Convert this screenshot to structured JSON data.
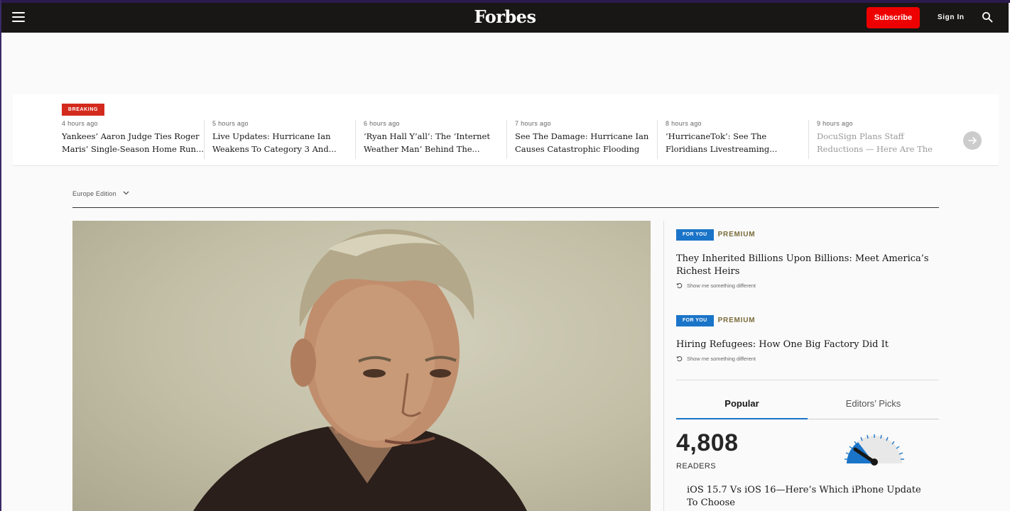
{
  "header": {
    "logo": "Forbes",
    "subscribe_label": "Subscribe",
    "signin_label": "Sign In"
  },
  "breaking": {
    "badge": "BREAKING",
    "stories": [
      {
        "time": "4 hours ago",
        "title": "Yankees’ Aaron Judge Ties Roger Maris’ Single-Season Home Run..."
      },
      {
        "time": "5 hours ago",
        "title": "Live Updates: Hurricane Ian Weakens To Category 3 And..."
      },
      {
        "time": "6 hours ago",
        "title": "‘Ryan Hall Y’all’: The ‘Internet Weather Man’ Behind The..."
      },
      {
        "time": "7 hours ago",
        "title": "See The Damage: Hurricane Ian Causes Catastrophic Flooding In..."
      },
      {
        "time": "8 hours ago",
        "title": "‘HurricaneTok’: See The Floridians Livestreaming..."
      },
      {
        "time": "9 hours ago",
        "title": "DocuSign Plans Staff Reductions — Here Are The Major U.S. Layoffs..."
      }
    ]
  },
  "edition": {
    "label": "Europe Edition"
  },
  "sidebar": {
    "cards": [
      {
        "tag": "FOR YOU",
        "badge": "PREMIUM",
        "title": "They Inherited Billions Upon Billions: Meet America’s Richest Heirs",
        "shuffle": "Show me something different"
      },
      {
        "tag": "FOR YOU",
        "badge": "PREMIUM",
        "title": "Hiring Refugees: How One Big Factory Did It",
        "shuffle": "Show me something different"
      }
    ],
    "tabs": [
      {
        "label": "Popular",
        "active": true
      },
      {
        "label": "Editors’ Picks",
        "active": false
      }
    ],
    "readers": {
      "count": "4,808",
      "label": "READERS"
    },
    "popular_story": "iOS 15.7 Vs iOS 16—Here’s Which iPhone Update To Choose"
  },
  "colors": {
    "header_bg": "#181716",
    "subscribe": "#ee0000",
    "breaking": "#d32a1d",
    "for_you": "#1a74c8",
    "premium": "#7a6b3a"
  }
}
